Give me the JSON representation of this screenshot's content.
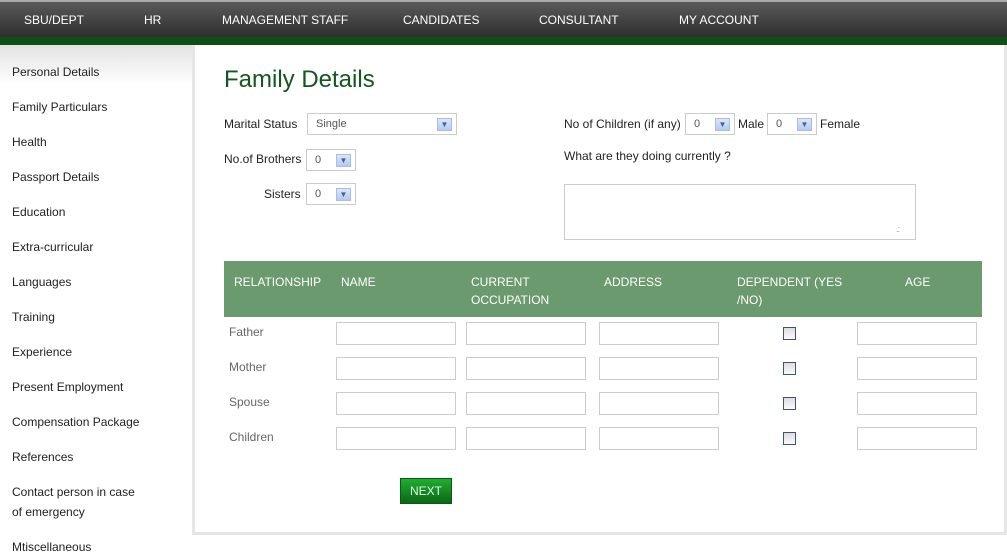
{
  "nav": [
    "SBU/DEPT",
    "HR",
    "MANAGEMENT STAFF",
    "CANDIDATES",
    "CONSULTANT",
    "MY ACCOUNT"
  ],
  "sidebar": [
    "Personal Details",
    "Family Particulars",
    "Health",
    "Passport Details",
    "Education",
    "Extra-curricular",
    "Languages",
    "Training",
    "Experience",
    "Present Employment",
    "Compensation Package",
    "References",
    "Contact person in case",
    "of emergency",
    "Mtiscellaneous"
  ],
  "page_title": "Family Details",
  "form": {
    "marital_label": "Marital Status",
    "marital_value": "Single",
    "brothers_label": "No.of Brothers",
    "brothers_value": "0",
    "sisters_label": "Sisters",
    "sisters_value": "0",
    "children_label": "No of Children (if any)",
    "male_value": "0",
    "male_label": "Male",
    "female_value": "0",
    "female_label": "Female",
    "doing_label": "What are they doing currently ?",
    "doing_value": ""
  },
  "table": {
    "headers": [
      "RELATIONSHIP",
      "NAME",
      "CURRENT",
      "OCCUPATION",
      "ADDRESS",
      "DEPENDENT (YES",
      "/NO)",
      "AGE"
    ],
    "rows": [
      "Father",
      "Mother",
      "Spouse",
      "Children"
    ]
  },
  "next_label": "NEXT",
  "colors": {
    "accent": "#14561f",
    "header": "#6a9a6d"
  }
}
